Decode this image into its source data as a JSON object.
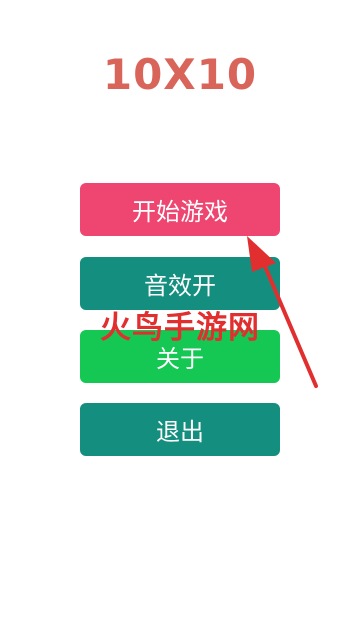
{
  "app": {
    "title": "10X10"
  },
  "menu": {
    "start_label": "开始游戏",
    "sound_label": "音效开",
    "about_label": "关于",
    "exit_label": "退出"
  },
  "colors": {
    "title": "#d9655a",
    "start_button": "#ee4571",
    "sound_button": "#148f7f",
    "about_button": "#14c853",
    "exit_button": "#148f7f",
    "annotation": "#e12f2f"
  },
  "overlay": {
    "watermark_text": "火鸟手游网",
    "arrow_icon": "arrow-pointer-icon"
  }
}
